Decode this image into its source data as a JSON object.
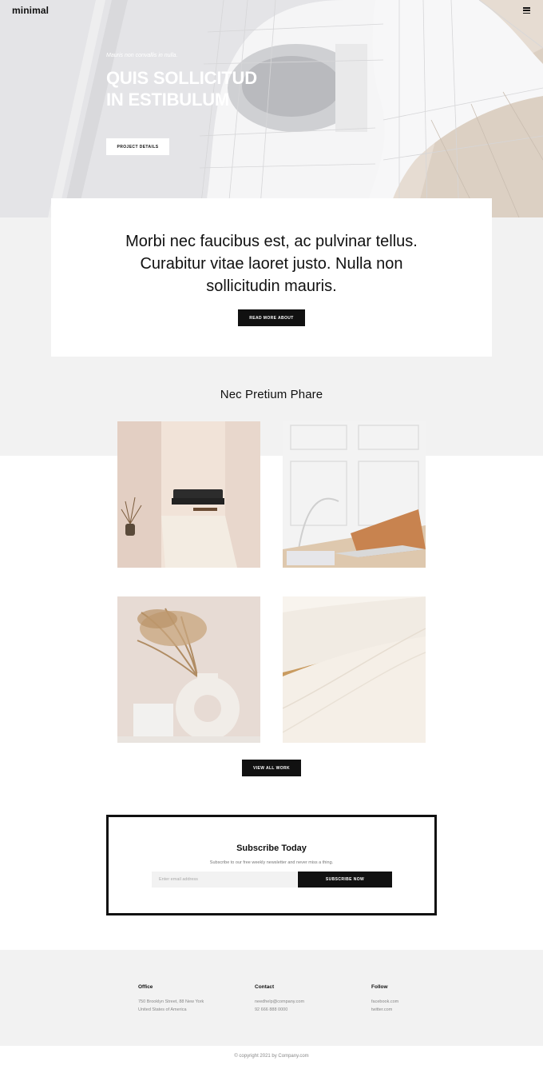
{
  "header": {
    "logo": "minimal",
    "menu_icon": "hamburger-menu-icon"
  },
  "hero": {
    "kicker": "Mauris non convallis in nulla.",
    "title_lines": [
      "QUIS SOLLICITUD",
      "IN ESTIBULUM"
    ],
    "button": "PROJECT DETAILS"
  },
  "intro": {
    "text": "Morbi nec faucibus est, ac pulvinar tellus. Curabitur vitae laoret justo. Nulla non sollicitudin mauris.",
    "button": "READ MORE ABOUT"
  },
  "portfolio": {
    "title": "Nec Pretium Phare",
    "tiles": [
      "living-room-photo",
      "laptop-desk-photo",
      "donut-vase-photo",
      "curved-architecture-photo"
    ],
    "button": "VIEW ALL WORK"
  },
  "subscribe": {
    "title": "Subscribe Today",
    "text": "Subscribe to our free weekly newsletter and never miss a thing.",
    "placeholder": "Enter email address",
    "button": "SUBSCRIBE NOW"
  },
  "footer": {
    "office": {
      "heading": "Office",
      "lines": [
        "750 Brooklyn Street, 88 New York",
        "United States of America"
      ]
    },
    "contact": {
      "heading": "Contact",
      "lines": [
        "needhelp@company.com",
        "92 666 888 0000"
      ]
    },
    "follow": {
      "heading": "Follow",
      "lines": [
        "facebook.com",
        "twitter.com"
      ]
    },
    "copyright": "© copyright 2021 by Company.com"
  }
}
